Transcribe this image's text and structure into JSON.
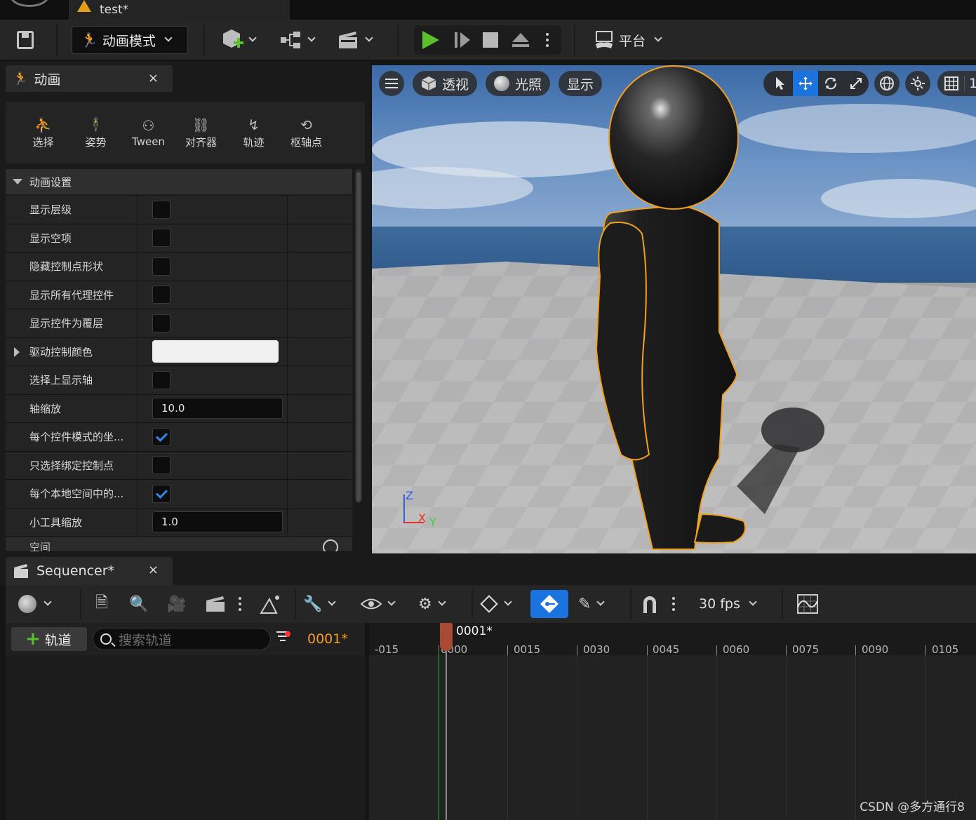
{
  "document_tab": {
    "title": "test*"
  },
  "main_toolbar": {
    "mode_label": "动画模式",
    "platform_label": "平台",
    "icons": [
      "save-icon",
      "add-actor-icon",
      "blueprint-icon",
      "cinematics-icon",
      "play-icon",
      "advance-frame-icon",
      "stop-icon",
      "eject-icon",
      "more-options-icon",
      "platform-icon"
    ]
  },
  "anim_panel": {
    "tab_label": "动画",
    "close_glyph": "×",
    "tools": [
      {
        "label": "选择",
        "icon": "select-tool-icon",
        "glyph": "⛹"
      },
      {
        "label": "姿势",
        "icon": "pose-tool-icon",
        "glyph": "🕴"
      },
      {
        "label": "Tween",
        "icon": "tween-tool-icon",
        "glyph": "⚇"
      },
      {
        "label": "对齐器",
        "icon": "snapper-tool-icon",
        "glyph": "⛓"
      },
      {
        "label": "轨迹",
        "icon": "motion-trail-icon",
        "glyph": "↯"
      },
      {
        "label": "枢轴点",
        "icon": "pivot-tool-icon",
        "glyph": "⟲"
      }
    ],
    "section_header": "动画设置",
    "properties": [
      {
        "label": "显示层级",
        "type": "checkbox",
        "checked": false
      },
      {
        "label": "显示空项",
        "type": "checkbox",
        "checked": false
      },
      {
        "label": "隐藏控制点形状",
        "type": "checkbox",
        "checked": false
      },
      {
        "label": "显示所有代理控件",
        "type": "checkbox",
        "checked": false
      },
      {
        "label": "显示控件为覆层",
        "type": "checkbox",
        "checked": false
      },
      {
        "label": "驱动控制颜色",
        "type": "color",
        "value": "#f0f0f0"
      },
      {
        "label": "选择上显示轴",
        "type": "checkbox",
        "checked": false
      },
      {
        "label": "轴缩放",
        "type": "number",
        "value": "10.0"
      },
      {
        "label": "每个控件模式的坐...",
        "type": "checkbox",
        "checked": true
      },
      {
        "label": "只选择绑定控制点",
        "type": "checkbox",
        "checked": false
      },
      {
        "label": "每个本地空间中的...",
        "type": "checkbox",
        "checked": true
      },
      {
        "label": "小工具缩放",
        "type": "number",
        "value": "1.0"
      }
    ],
    "next_section_partial": "空间"
  },
  "viewport": {
    "perspective_label": "透视",
    "lighting_label": "光照",
    "show_label": "显示",
    "grid_snap_value": "1",
    "axis": {
      "z": "Z",
      "x": "X",
      "y": "Y"
    }
  },
  "sequencer": {
    "tab_label": "Sequencer*",
    "close_glyph": "×",
    "add_track_label": "轨道",
    "search_placeholder": "搜索轨道",
    "current_frame": "0001*",
    "fps_label": "30 fps",
    "playhead_label": "0001*",
    "ruler_ticks": [
      "-015",
      "0000",
      "0015",
      "0030",
      "0045",
      "0060",
      "0075",
      "0090",
      "0105"
    ]
  },
  "watermark": "CSDN @多方通行8",
  "colors": {
    "accent": "#1b73e0",
    "play_green": "#5bc12a",
    "frame_orange": "#f09d28",
    "selection_outline": "#f0a020"
  }
}
